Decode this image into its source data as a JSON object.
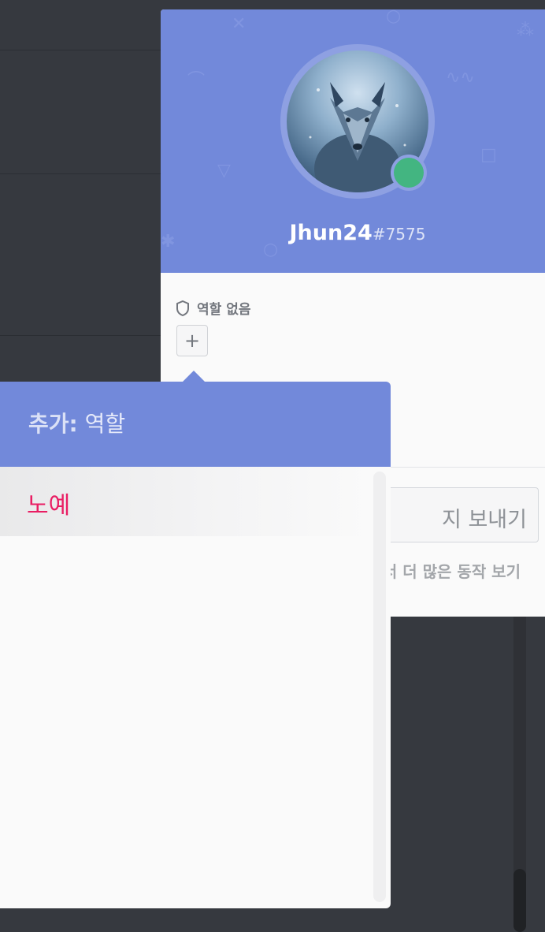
{
  "profile": {
    "username": "Jhun24",
    "discriminator": "#7575",
    "status_color": "#43b581",
    "accent_color": "#7289da",
    "roles_header": "역할 없음",
    "add_role_symbol": "+",
    "message_placeholder": "지 보내기",
    "tip_text": "다음에서 오른쪽 클릭해서 더 많은 동작 보기"
  },
  "role_popout": {
    "title_prefix": "추가:",
    "title": "역할",
    "roles": [
      {
        "name": "노예",
        "color": "#e91e63"
      }
    ]
  }
}
